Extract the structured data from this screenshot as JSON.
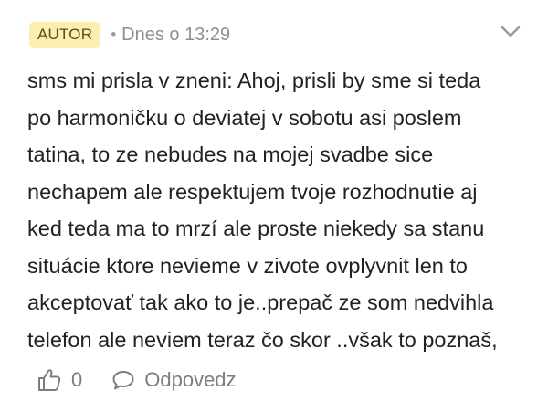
{
  "comment": {
    "badge": "AUTOR",
    "separator": "•",
    "timestamp": "Dnes o 13:29",
    "text": "sms mi prisla v zneni: Ahoj, prisli by sme si teda\npo harmoničku o deviatej v sobotu asi poslem\ntatina, to ze nebudes na mojej svadbe sice\nnechapem ale respektujem tvoje rozhodnutie aj\nked teda ma to mrzí ale proste niekedy sa stanu\nsituácie ktore nevieme v zivote ovplyvnit len to\nakceptovať tak ako to je..prepač ze som nedvihla\ntelefon ale neviem teraz čo skor ..však to poznaš,",
    "likes": "0",
    "reply_label": "Odpovedz"
  },
  "icons": {
    "expand": "chevron-down-icon",
    "like": "thumbs-up-icon",
    "reply": "speech-bubble-icon"
  },
  "colors": {
    "badge_bg": "#fbefb0",
    "text": "#222222",
    "muted": "#8f8f8f"
  }
}
